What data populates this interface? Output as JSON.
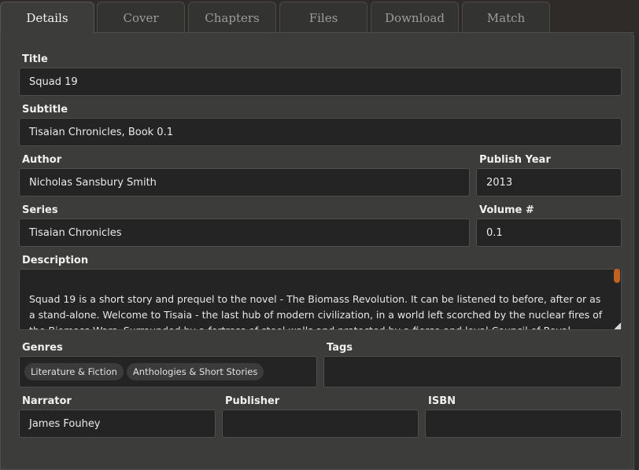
{
  "tabs": [
    {
      "label": "Details"
    },
    {
      "label": "Cover"
    },
    {
      "label": "Chapters"
    },
    {
      "label": "Files"
    },
    {
      "label": "Download"
    },
    {
      "label": "Match"
    }
  ],
  "fields": {
    "title": {
      "label": "Title",
      "value": "Squad 19"
    },
    "subtitle": {
      "label": "Subtitle",
      "value": "Tisaian Chronicles, Book 0.1"
    },
    "author": {
      "label": "Author",
      "value": "Nicholas Sansbury Smith"
    },
    "publish_year": {
      "label": "Publish Year",
      "value": "2013"
    },
    "series": {
      "label": "Series",
      "value": "Tisaian Chronicles"
    },
    "volume": {
      "label": "Volume #",
      "value": "0.1"
    },
    "description": {
      "label": "Description",
      "value": "Squad 19 is a short story and prequel to the novel - The Biomass Revolution. It can be listened to before, after or as a stand-alone. Welcome to Tisaia - the last hub of modern civilization, in a world left scorched by the nuclear fires of the Biomass Wars. Surrounded by a fortress of steel walls and protected by a fierce and loyal Council of Royal Knights, Tisaia now exclusively..."
    },
    "genres": {
      "label": "Genres",
      "items": [
        "Literature & Fiction",
        "Anthologies & Short Stories"
      ]
    },
    "tags": {
      "label": "Tags"
    },
    "narrator": {
      "label": "Narrator",
      "value": "James Fouhey"
    },
    "publisher": {
      "label": "Publisher",
      "value": ""
    },
    "isbn": {
      "label": "ISBN",
      "value": ""
    }
  },
  "colors": {
    "scrollbar": "#c0621f",
    "field_bg": "#242424",
    "panel_bg": "#3c3d3b"
  }
}
